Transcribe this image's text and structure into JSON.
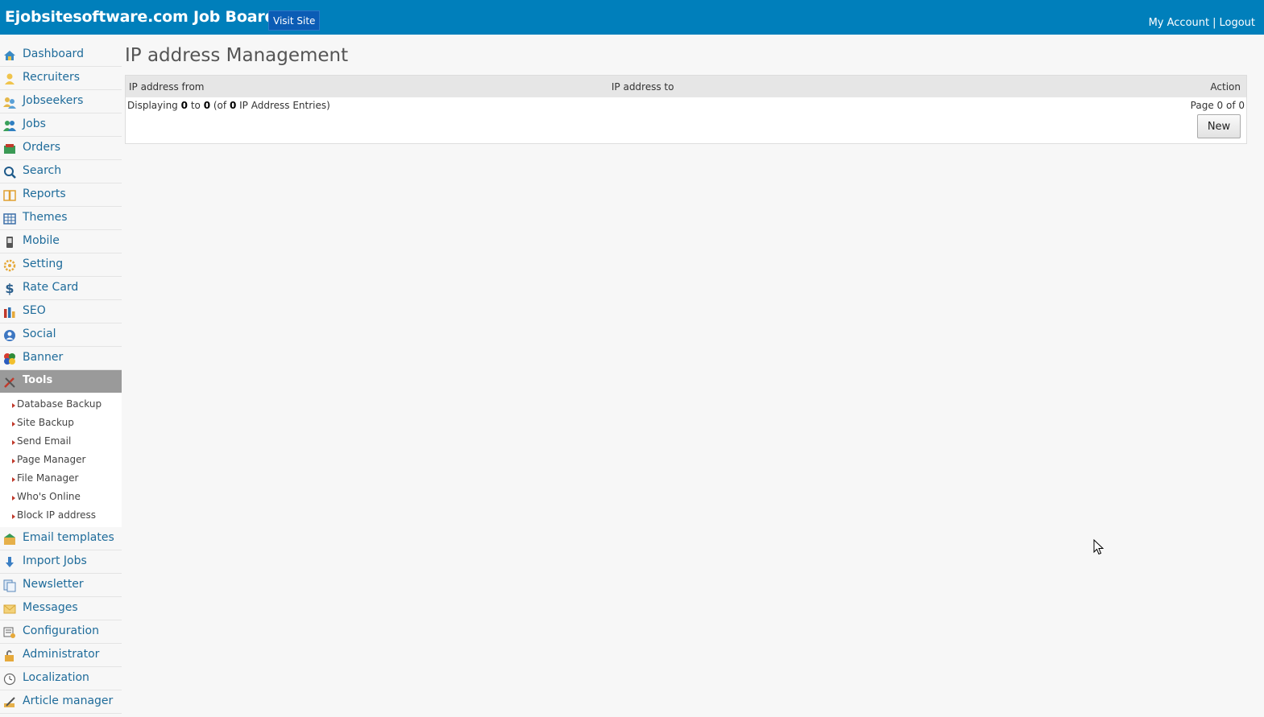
{
  "header": {
    "brand": "Ejobsitesoftware.com Job Board",
    "visit_site": "Visit Site",
    "my_account": "My Account",
    "separator": "|",
    "logout": "Logout"
  },
  "sidebar": {
    "items_top": [
      {
        "label": "Dashboard",
        "icon": "home-icon"
      },
      {
        "label": "Recruiters",
        "icon": "user-icon"
      },
      {
        "label": "Jobseekers",
        "icon": "users-icon"
      },
      {
        "label": "Jobs",
        "icon": "people-icon"
      },
      {
        "label": "Orders",
        "icon": "cart-icon"
      },
      {
        "label": "Search",
        "icon": "search-icon"
      },
      {
        "label": "Reports",
        "icon": "book-icon"
      },
      {
        "label": "Themes",
        "icon": "grid-icon"
      },
      {
        "label": "Mobile",
        "icon": "mobile-icon"
      },
      {
        "label": "Setting",
        "icon": "gear-icon"
      },
      {
        "label": "Rate Card",
        "icon": "dollar-icon"
      },
      {
        "label": "SEO",
        "icon": "bar-chart-icon"
      },
      {
        "label": "Social",
        "icon": "social-icon"
      },
      {
        "label": "Banner",
        "icon": "banner-icon"
      }
    ],
    "active": {
      "label": "Tools",
      "icon": "tools-icon"
    },
    "tools_submenu": [
      "Database Backup",
      "Site Backup",
      "Send Email",
      "Page Manager",
      "File Manager",
      "Who's Online",
      "Block IP address"
    ],
    "items_bottom": [
      {
        "label": "Email templates",
        "icon": "envelope-open-icon"
      },
      {
        "label": "Import Jobs",
        "icon": "download-icon"
      },
      {
        "label": "Newsletter",
        "icon": "newsletter-icon"
      },
      {
        "label": "Messages",
        "icon": "mail-icon"
      },
      {
        "label": "Configuration",
        "icon": "config-icon"
      },
      {
        "label": "Administrator",
        "icon": "lock-icon"
      },
      {
        "label": "Localization",
        "icon": "clock-icon"
      },
      {
        "label": "Article manager",
        "icon": "pen-icon"
      }
    ]
  },
  "main": {
    "title": "IP address Management",
    "columns": {
      "from": "IP address from",
      "to": "IP address to",
      "action": "Action"
    },
    "info": {
      "prefix": "Displaying",
      "start": "0",
      "to_word": "to",
      "end": "0",
      "of_open": "(of",
      "total": "0",
      "suffix": "IP Address Entries)"
    },
    "pagination": "Page 0 of 0",
    "new_button": "New"
  }
}
